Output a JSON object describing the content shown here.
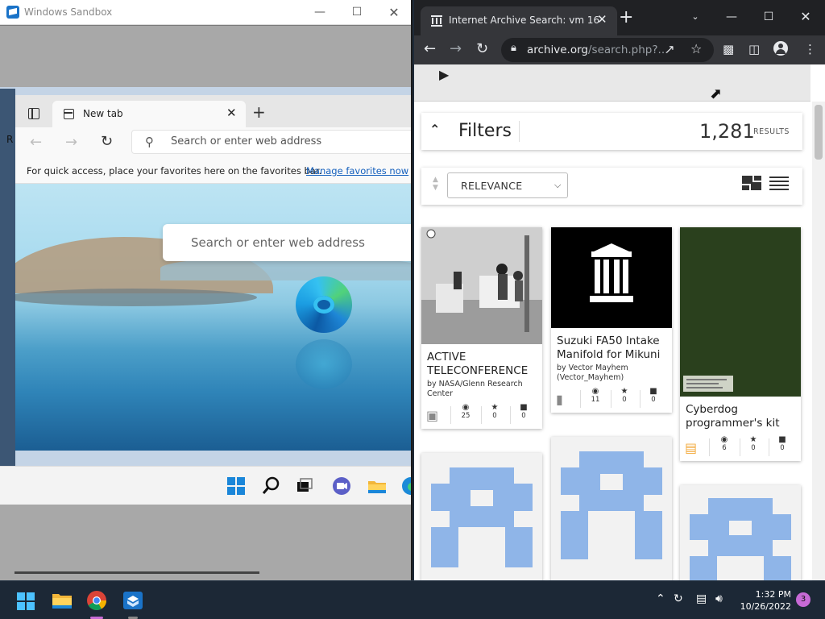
{
  "sandbox": {
    "title": "Windows Sandbox",
    "desktop_label": "R",
    "edge": {
      "tab_title": "New tab",
      "address_placeholder": "Search or enter web address",
      "favorites_message": "For quick access, place your favorites here on the favorites bar.",
      "favorites_link": "Manage favorites now",
      "search_placeholder": "Search or enter web address"
    },
    "taskbar_icons": [
      "windows-start-icon",
      "search-icon",
      "task-view-icon",
      "teams-chat-icon",
      "file-explorer-icon",
      "edge-icon"
    ]
  },
  "chrome": {
    "tab_title": "Internet Archive Search: vm 16",
    "url_host": "archive.org",
    "url_path": "/search.php?...",
    "page": {
      "filters_label": "Filters",
      "results_count": "1,281",
      "results_label": "RESULTS",
      "sort_value": "RELEVANCE",
      "items": [
        {
          "title": "ACTIVE TELECONFERENCE",
          "byline": "by NASA/Glenn Research Center",
          "views": "25",
          "favorites": "0",
          "reviews": "0",
          "media_icon": "image-icon"
        },
        {
          "title": "Suzuki FA50 Intake Manifold for Mikuni",
          "byline": "by Vector Mayhem (Vector_Mayhem)",
          "views": "11",
          "favorites": "0",
          "reviews": "0",
          "media_icon": "folder-icon"
        },
        {
          "title": "Cyberdog programmer's kit",
          "byline": "",
          "views": "6",
          "favorites": "0",
          "reviews": "0",
          "media_icon": "book-icon"
        }
      ]
    }
  },
  "host_taskbar": {
    "time": "1:32 PM",
    "date": "10/26/2022",
    "notification_count": "3"
  }
}
